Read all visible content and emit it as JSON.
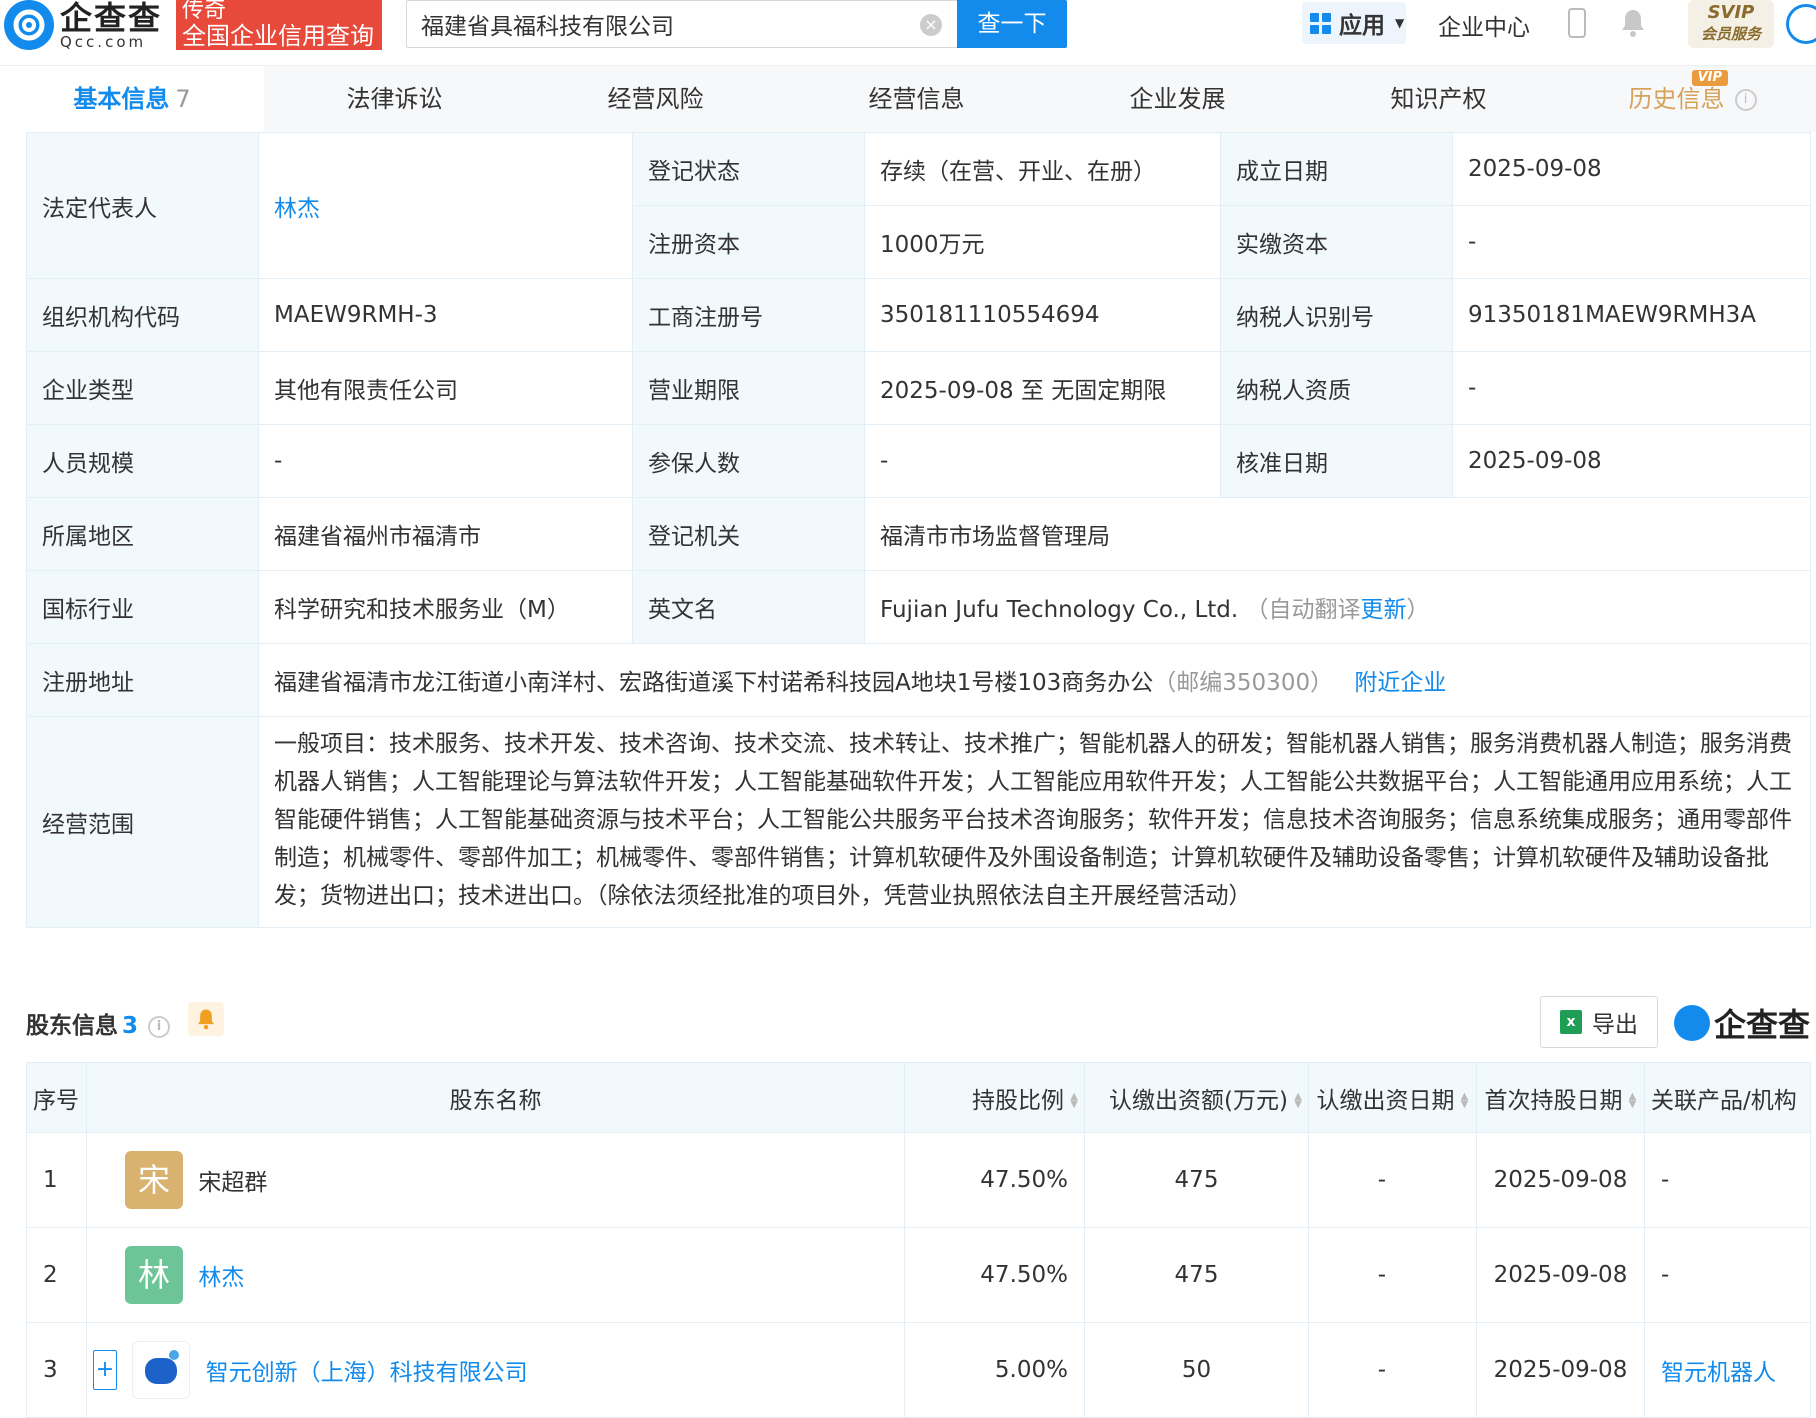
{
  "header": {
    "logo_cn": "企查查",
    "logo_en": "Qcc.com",
    "promo_line1": "传奇",
    "promo_line2": "全国企业信用查询",
    "search_value": "福建省具福科技有限公司",
    "search_button": "查一下",
    "apps_label": "应用",
    "enterprise_center": "企业中心",
    "svip_line1": "SVIP",
    "svip_line2": "会员服务"
  },
  "tabs": [
    {
      "label": "基本信息",
      "count": "7"
    },
    {
      "label": "法律诉讼"
    },
    {
      "label": "经营风险"
    },
    {
      "label": "经营信息"
    },
    {
      "label": "企业发展"
    },
    {
      "label": "知识产权"
    },
    {
      "label": "历史信息",
      "badge": "VIP"
    }
  ],
  "basic_info": {
    "legal_rep_label": "法定代表人",
    "legal_rep": "林杰",
    "reg_status_label": "登记状态",
    "reg_status": "存续（在营、开业、在册）",
    "founded_label": "成立日期",
    "founded": "2025-09-08",
    "reg_capital_label": "注册资本",
    "reg_capital": "1000万元",
    "paid_capital_label": "实缴资本",
    "paid_capital": "-",
    "org_code_label": "组织机构代码",
    "org_code": "MAEW9RMH-3",
    "biz_reg_no_label": "工商注册号",
    "biz_reg_no": "350181110554694",
    "taxpayer_id_label": "纳税人识别号",
    "taxpayer_id": "91350181MAEW9RMH3A",
    "type_label": "企业类型",
    "type": "其他有限责任公司",
    "term_label": "营业期限",
    "term": "2025-09-08 至 无固定期限",
    "tax_qual_label": "纳税人资质",
    "tax_qual": "-",
    "staff_label": "人员规模",
    "staff": "-",
    "insured_label": "参保人数",
    "insured": "-",
    "approved_label": "核准日期",
    "approved": "2025-09-08",
    "region_label": "所属地区",
    "region": "福建省福州市福清市",
    "authority_label": "登记机关",
    "authority": "福清市市场监督管理局",
    "industry_label": "国标行业",
    "industry": "科学研究和技术服务业（M）",
    "en_name_label": "英文名",
    "en_name": "Fujian Jufu Technology Co., Ltd.",
    "en_auto_prefix": "（自动翻译",
    "en_update": "更新",
    "en_auto_suffix": "）",
    "address_label": "注册地址",
    "address": "福建省福清市龙江街道小南洋村、宏路街道溪下村诺希科技园A地块1号楼103商务办公",
    "postcode": "（邮编350300）",
    "nearby": "附近企业",
    "scope_label": "经营范围",
    "scope": "一般项目：技术服务、技术开发、技术咨询、技术交流、技术转让、技术推广；智能机器人的研发；智能机器人销售；服务消费机器人制造；服务消费机器人销售；人工智能理论与算法软件开发；人工智能基础软件开发；人工智能应用软件开发；人工智能公共数据平台；人工智能通用应用系统；人工智能硬件销售；人工智能基础资源与技术平台；人工智能公共服务平台技术咨询服务；软件开发；信息技术咨询服务；信息系统集成服务；通用零部件制造；机械零件、零部件加工；机械零件、零部件销售；计算机软硬件及外围设备制造；计算机软硬件及辅助设备零售；计算机软硬件及辅助设备批发；货物进出口；技术进出口。（除依法须经批准的项目外，凭营业执照依法自主开展经营活动）"
  },
  "shareholders": {
    "title": "股东信息",
    "count": "3",
    "export_label": "导出",
    "watermark": "企查查",
    "columns": [
      "序号",
      "股东名称",
      "持股比例",
      "认缴出资额(万元)",
      "认缴出资日期",
      "首次持股日期",
      "关联产品/机构"
    ],
    "rows": [
      {
        "no": "1",
        "avatar_char": "宋",
        "avatar_color": "#d8b26e",
        "name": "宋超群",
        "ratio": "47.50%",
        "amount": "475",
        "sub_date": "-",
        "first_date": "2025-09-08",
        "related": "-"
      },
      {
        "no": "2",
        "avatar_char": "林",
        "avatar_color": "#6cc497",
        "name": "林杰",
        "ratio": "47.50%",
        "amount": "475",
        "sub_date": "-",
        "first_date": "2025-09-08",
        "related": "-"
      },
      {
        "no": "3",
        "avatar_char": "",
        "name": "智元创新（上海）科技有限公司",
        "ratio": "5.00%",
        "amount": "50",
        "sub_date": "-",
        "first_date": "2025-09-08",
        "related": "智元机器人"
      }
    ]
  },
  "colors": {
    "accent": "#128bed",
    "promo": "#e74a3b",
    "label_bg": "#f2f9fc"
  }
}
